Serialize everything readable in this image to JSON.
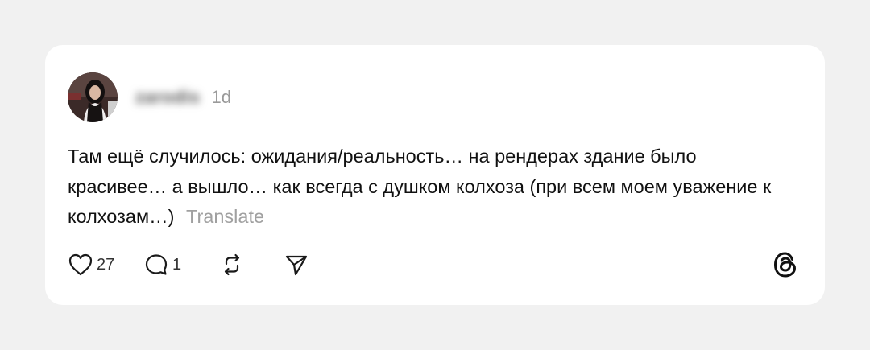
{
  "post": {
    "username": "zarodis",
    "time": "1d",
    "text": "Там ещё случилось: ожидания/реальность… на рендерах здание было красивее… а вышло… как всегда с душком колхоза (при всем моем уважение к колхозам…)",
    "translate_label": "Translate"
  },
  "actions": {
    "likes": "27",
    "replies": "1"
  },
  "icons": {
    "like": "heart-icon",
    "reply": "comment-icon",
    "repost": "repost-icon",
    "share": "send-icon",
    "brand": "threads-logo-icon"
  }
}
